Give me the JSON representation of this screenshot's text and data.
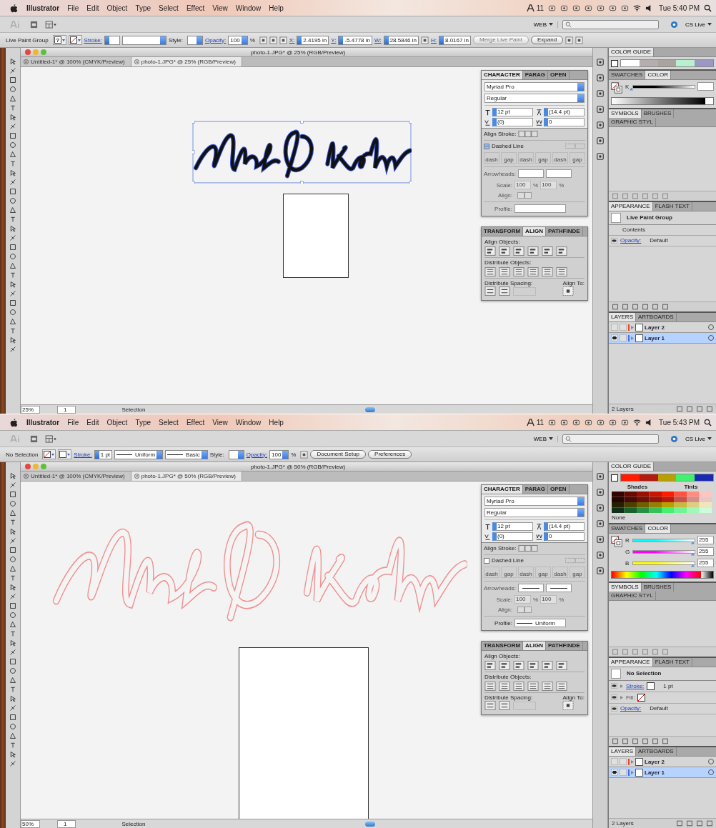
{
  "screens": [
    {
      "menubar": {
        "app": "Illustrator",
        "menus": [
          "File",
          "Edit",
          "Object",
          "Type",
          "Select",
          "Effect",
          "View",
          "Window",
          "Help"
        ],
        "badge": "11",
        "clock": "Tue 5:40 PM"
      },
      "appbar": {
        "workspace": "WEB",
        "cs_live": "CS Live"
      },
      "control_bar": [
        {
          "kind": "label",
          "text": "Live Paint Group"
        },
        {
          "kind": "swatch",
          "text": "?",
          "none": false
        },
        {
          "kind": "swatch",
          "none": true
        },
        {
          "kind": "link",
          "text": "Stroke:"
        },
        {
          "kind": "spin-field"
        },
        {
          "kind": "brush-field"
        },
        {
          "kind": "label",
          "text": "Style:"
        },
        {
          "kind": "style-field"
        },
        {
          "kind": "link",
          "text": "Opacity:"
        },
        {
          "kind": "field",
          "text": "100"
        },
        {
          "kind": "label",
          "text": "%"
        },
        {
          "kind": "icon"
        },
        {
          "kind": "icon"
        },
        {
          "kind": "icon"
        },
        {
          "kind": "link",
          "text": "X:"
        },
        {
          "kind": "spin-field",
          "text": "2.4195 in"
        },
        {
          "kind": "link",
          "text": "Y:"
        },
        {
          "kind": "spin-field",
          "text": "-5.4778 in"
        },
        {
          "kind": "link",
          "text": "W:"
        },
        {
          "kind": "spin-field",
          "text": "28.5846 in"
        },
        {
          "kind": "icon"
        },
        {
          "kind": "link",
          "text": "H:"
        },
        {
          "kind": "spin-field",
          "text": "8.0167 in"
        },
        {
          "kind": "button",
          "text": "Merge Live Paint",
          "disabled": true
        },
        {
          "kind": "button",
          "text": "Expand",
          "disabled": false
        },
        {
          "kind": "icon"
        },
        {
          "kind": "icon"
        }
      ],
      "document": {
        "title": "photo-1.JPG* @ 25% (RGB/Preview)",
        "tabs": [
          {
            "label": "Untitled-1* @ 100% (CMYK/Preview)",
            "selected": false
          },
          {
            "label": "photo-1.JPG* @ 25% (RGB/Preview)",
            "selected": true
          }
        ],
        "signature": {
          "kind": "filled",
          "selected": true
        },
        "status": {
          "zoom": "25%",
          "page": "1",
          "tool": "Selection"
        }
      },
      "character_panel": {
        "tabs": [
          {
            "label": "CHARACTER",
            "selected": true
          },
          {
            "label": "PARAG",
            "selected": false
          },
          {
            "label": "OPEN",
            "selected": false
          }
        ],
        "font": "Myriad Pro",
        "style": "Regular",
        "size": "12 pt",
        "leading": "(14.4 pt)",
        "kerning": "(0)",
        "tracking": "0"
      },
      "stroke_panel": {
        "align_stroke": "Align Stroke:",
        "dashed": {
          "label": "Dashed Line",
          "mixed": true
        },
        "dash_labels": [
          "dash",
          "gap",
          "dash",
          "gap",
          "dash",
          "gap"
        ],
        "arrowheads": "Arrowheads:",
        "arrow_lines": false,
        "scale": "Scale:",
        "scale_values": [
          "100",
          "100"
        ],
        "percent": "%",
        "align": "Align:",
        "profile": "Profile:"
      },
      "align_panel": {
        "tabs": [
          {
            "label": "TRANSFORM",
            "selected": false
          },
          {
            "label": "ALIGN",
            "selected": true
          },
          {
            "label": "PATHFINDE",
            "selected": false
          }
        ],
        "align_objects": "Align Objects:",
        "distribute_objects": "Distribute Objects:",
        "distribute_spacing": "Distribute Spacing:",
        "align_to": "Align To:"
      },
      "color_guide": {
        "title": "COLOR GUIDE",
        "colors": [
          {
            "color": "#ffffff"
          },
          {
            "color": "#b4aeae"
          },
          {
            "color": "#a9a49f"
          },
          {
            "color": "#b9f0cf"
          },
          {
            "color": "#9c98c4"
          }
        ],
        "expanded": false
      },
      "color_panel": {
        "tabs": [
          {
            "label": "SWATCHES",
            "selected": false
          },
          {
            "label": "COLOR",
            "selected": true
          }
        ],
        "channels": [
          {
            "name": "K",
            "color": "#000000",
            "level": 0
          }
        ],
        "spectrum": {
          "kind": "gray"
        }
      },
      "symbols_panel": {
        "tabs": [
          {
            "label": "SYMBOLS",
            "selected": true
          },
          {
            "label": "BRUSHES",
            "selected": false
          },
          {
            "label": "GRAPHIC STYL",
            "selected": false
          }
        ]
      },
      "appearance": {
        "tabs": [
          {
            "label": "APPEARANCE",
            "selected": true
          },
          {
            "label": "FLASH TEXT",
            "selected": false
          }
        ],
        "header": "Live Paint Group",
        "rows": [
          {
            "kind": "text",
            "label": "Contents"
          },
          {
            "kind": "opacity",
            "label": "Opacity:",
            "value": "Default"
          }
        ]
      },
      "layers": {
        "tabs": [
          {
            "label": "LAYERS",
            "selected": true
          },
          {
            "label": "ARTBOARDS",
            "selected": false
          }
        ],
        "items": [
          {
            "name": "Layer 2",
            "color": "#e8432e",
            "visible": false,
            "selected": false
          },
          {
            "name": "Layer 1",
            "color": "#3f6ff0",
            "visible": true,
            "selected": true
          }
        ],
        "footer": "2 Layers"
      }
    },
    {
      "menubar": {
        "app": "Illustrator",
        "menus": [
          "File",
          "Edit",
          "Object",
          "Type",
          "Select",
          "Effect",
          "View",
          "Window",
          "Help"
        ],
        "badge": "11",
        "clock": "Tue 5:43 PM"
      },
      "appbar": {
        "workspace": "WEB",
        "cs_live": "CS Live"
      },
      "control_bar": [
        {
          "kind": "label",
          "text": "No Selection"
        },
        {
          "kind": "swatch",
          "none": true
        },
        {
          "kind": "swatch",
          "none": false
        },
        {
          "kind": "link",
          "text": "Stroke:"
        },
        {
          "kind": "spin-field",
          "text": "1 pt"
        },
        {
          "kind": "line-field",
          "text": "Uniform"
        },
        {
          "kind": "line-field",
          "text": "Basic"
        },
        {
          "kind": "label",
          "text": "Style:"
        },
        {
          "kind": "style-field"
        },
        {
          "kind": "link",
          "text": "Opacity:"
        },
        {
          "kind": "field",
          "text": "100"
        },
        {
          "kind": "label",
          "text": "%"
        },
        {
          "kind": "icon"
        },
        {
          "kind": "button",
          "text": "Document Setup",
          "disabled": false
        },
        {
          "kind": "button",
          "text": "Preferences",
          "disabled": false
        }
      ],
      "document": {
        "title": "photo-1.JPG* @ 50% (RGB/Preview)",
        "tabs": [
          {
            "label": "Untitled-1* @ 100% (CMYK/Preview)",
            "selected": false
          },
          {
            "label": "photo-1.JPG* @ 50% (RGB/Preview)",
            "selected": true
          }
        ],
        "signature": {
          "kind": "outline",
          "selected": false
        },
        "status": {
          "zoom": "50%",
          "page": "1",
          "tool": "Selection"
        }
      },
      "character_panel": {
        "tabs": [
          {
            "label": "CHARACTER",
            "selected": true
          },
          {
            "label": "PARAG",
            "selected": false
          },
          {
            "label": "OPEN",
            "selected": false
          }
        ],
        "font": "Myriad Pro",
        "style": "Regular",
        "size": "12 pt",
        "leading": "(14.4 pt)",
        "kerning": "(0)",
        "tracking": "0"
      },
      "stroke_panel": {
        "align_stroke": "Align Stroke:",
        "dashed": {
          "label": "Dashed Line",
          "mixed": false
        },
        "dash_labels": [
          "dash",
          "gap",
          "dash",
          "gap",
          "dash",
          "gap"
        ],
        "arrowheads": "Arrowheads:",
        "arrow_lines": true,
        "scale": "Scale:",
        "scale_values": [
          "100",
          "100"
        ],
        "percent": "%",
        "align": "Align:",
        "profile": "Profile:",
        "profile_value": "Uniform"
      },
      "align_panel": {
        "tabs": [
          {
            "label": "TRANSFORM",
            "selected": false
          },
          {
            "label": "ALIGN",
            "selected": true
          },
          {
            "label": "PATHFINDE",
            "selected": false
          }
        ],
        "align_objects": "Align Objects:",
        "distribute_objects": "Distribute Objects:",
        "distribute_spacing": "Distribute Spacing:",
        "align_to": "Align To:"
      },
      "color_guide": {
        "title": "COLOR GUIDE",
        "colors": [
          {
            "color": "#ff1a00"
          },
          {
            "color": "#b31a10"
          },
          {
            "color": "#b8a000"
          },
          {
            "color": "#44f070"
          },
          {
            "color": "#1a2ab0"
          }
        ],
        "expanded": true,
        "shades": "Shades",
        "tints": "Tints",
        "none": "None"
      },
      "color_panel": {
        "tabs": [
          {
            "label": "SWATCHES",
            "selected": false
          },
          {
            "label": "COLOR",
            "selected": true
          }
        ],
        "channels": [
          {
            "name": "R",
            "color": "#00ffff",
            "level": 1,
            "value": "255"
          },
          {
            "name": "G",
            "color": "#ff00ff",
            "level": 1,
            "value": "255"
          },
          {
            "name": "B",
            "color": "#ffff00",
            "level": 1,
            "value": "255"
          }
        ],
        "spectrum": {
          "kind": "rgb"
        }
      },
      "symbols_panel": {
        "tabs": [
          {
            "label": "SYMBOLS",
            "selected": true
          },
          {
            "label": "BRUSHES",
            "selected": false
          },
          {
            "label": "GRAPHIC STYL",
            "selected": false
          }
        ]
      },
      "appearance": {
        "tabs": [
          {
            "label": "APPEARANCE",
            "selected": true
          },
          {
            "label": "FLASH TEXT",
            "selected": false
          }
        ],
        "header": "No Selection",
        "rows": [
          {
            "kind": "stroke",
            "label": "Stroke:",
            "value": "1 pt"
          },
          {
            "kind": "fill",
            "label": "Fill:"
          },
          {
            "kind": "opacity",
            "label": "Opacity:",
            "value": "Default"
          }
        ]
      },
      "layers": {
        "tabs": [
          {
            "label": "LAYERS",
            "selected": true
          },
          {
            "label": "ARTBOARDS",
            "selected": false
          }
        ],
        "items": [
          {
            "name": "Layer 2",
            "color": "#e8432e",
            "visible": false,
            "selected": false
          },
          {
            "name": "Layer 1",
            "color": "#3f6ff0",
            "visible": true,
            "selected": true
          }
        ],
        "footer": "2 Layers"
      }
    }
  ]
}
